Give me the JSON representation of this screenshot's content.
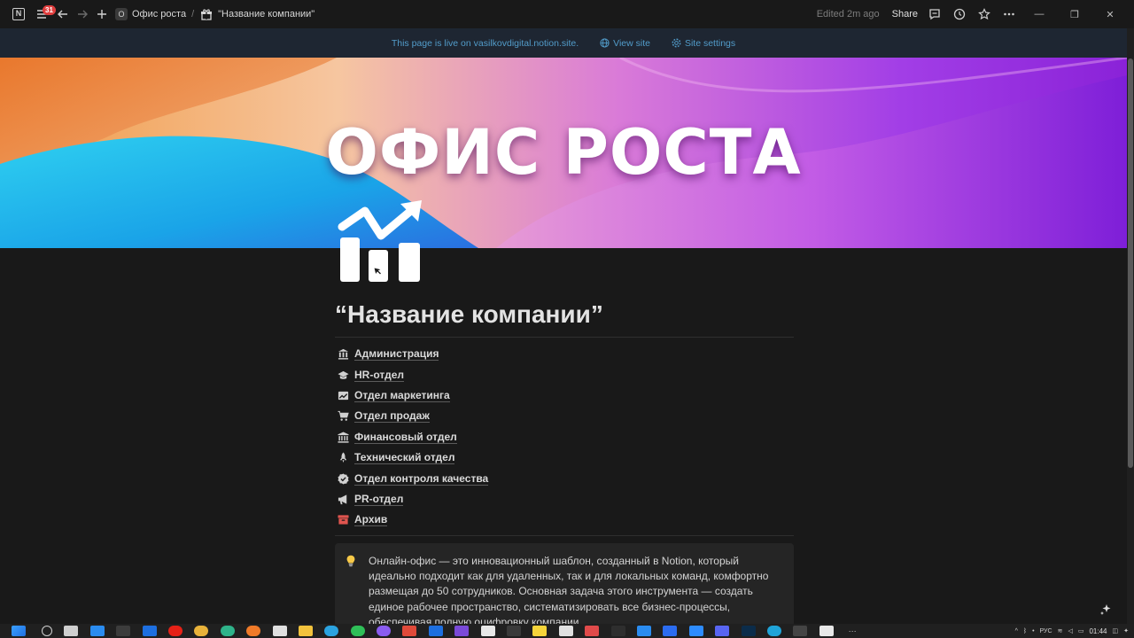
{
  "topbar": {
    "notifications_count": "31",
    "breadcrumb_root": "Офис роста",
    "breadcrumb_root_icon": "O",
    "breadcrumb_separator": "/",
    "breadcrumb_current": "\"Название компании\"",
    "edited": "Edited 2m ago",
    "share_label": "Share"
  },
  "banner": {
    "live_text": "This page is live on vasilkovdigital.notion.site.",
    "view_site": "View site",
    "site_settings": "Site settings",
    "color": "#529cca"
  },
  "cover": {
    "title": "ОФИС РОСТА"
  },
  "page": {
    "title": "“Название компании”",
    "links": [
      {
        "icon": "bank-icon",
        "label": "Администрация"
      },
      {
        "icon": "graduation-cap-icon",
        "label": "HR-отдел"
      },
      {
        "icon": "chart-line-icon",
        "label": "Отдел маркетинга"
      },
      {
        "icon": "shopping-cart-icon",
        "label": "Отдел продаж"
      },
      {
        "icon": "building-columns-icon",
        "label": "Финансовый отдел"
      },
      {
        "icon": "rocket-icon",
        "label": "Технический отдел"
      },
      {
        "icon": "check-badge-icon",
        "label": "Отдел контроля качества"
      },
      {
        "icon": "megaphone-icon",
        "label": "PR-отдел"
      },
      {
        "icon": "archive-icon",
        "label": "Архив"
      }
    ],
    "callout": {
      "icon": "lightbulb-icon",
      "text": "Онлайн-офис — это инновационный шаблон, созданный в Notion, который идеально подходит как для удаленных, так и для локальных команд, комфортно размещая до 50 сотрудников. Основная задача этого инструмента — создать единое рабочее пространство, систематизировать все бизнес-процессы, обеспечивая полную оцифровку компании."
    }
  },
  "taskbar": {
    "language": "РУС",
    "time": "01:44"
  }
}
